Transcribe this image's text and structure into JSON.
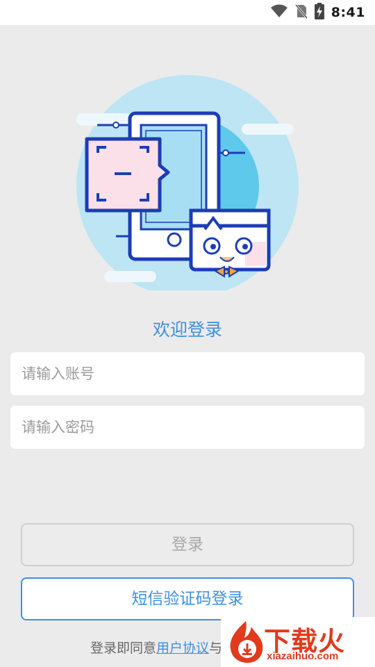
{
  "status_bar": {
    "time": "8:41",
    "icons": [
      "wifi-icon",
      "no-sim-icon",
      "battery-charging-icon"
    ]
  },
  "illustration": {
    "name": "phone-and-robot-illustration"
  },
  "welcome": {
    "title": "欢迎登录"
  },
  "form": {
    "account_placeholder": "请输入账号",
    "password_placeholder": "请输入密码"
  },
  "buttons": {
    "login_label": "登录",
    "sms_login_label": "短信验证码登录"
  },
  "agreement": {
    "prefix": "登录即同意",
    "user_agreement": "用户协议",
    "connector": "与"
  },
  "watermark": {
    "logo_text": "下载火",
    "site": "xiazaihuo.com"
  },
  "colors": {
    "accent": "#3d8fe0",
    "background": "#ebebeb",
    "watermark": "#e13a1c"
  }
}
